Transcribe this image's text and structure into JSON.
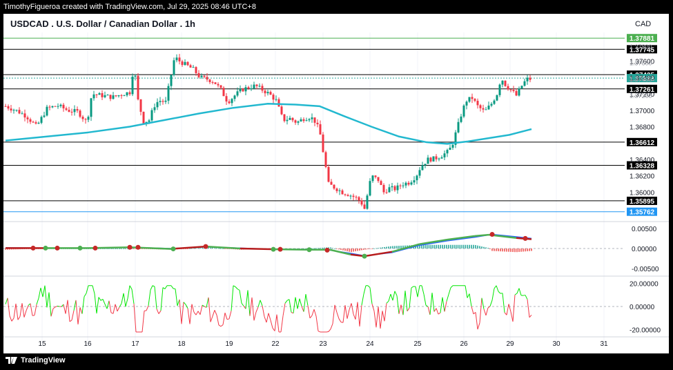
{
  "header": {
    "attribution": "TimothyFigueroa created with TradingView.com, Jul 29, 2025 08:46 UTC+8"
  },
  "footer": {
    "brand": "TradingView",
    "logo_icon": "tradingview-logo-icon"
  },
  "chart_data": {
    "type": "candlestick",
    "title": "USDCAD . U.S. Dollar / Canadian Dollar . 1h",
    "currency": "CAD",
    "x_ticks": [
      "15",
      "16",
      "17",
      "18",
      "19",
      "22",
      "23",
      "24",
      "25",
      "26",
      "29",
      "30",
      "31"
    ],
    "y_ticks": [
      "1.37600",
      "1.37400",
      "1.37200",
      "1.37000",
      "1.36800",
      "1.36400",
      "1.36200",
      "1.36000"
    ],
    "y_overlap_ticks": [
      "1.37800",
      "1.37600",
      "1.37400",
      "1.37200"
    ],
    "ylim": [
      1.3565,
      1.3795
    ],
    "price_lines": [
      {
        "label": "1.37881",
        "value": 1.37881,
        "color": "#4caf50"
      },
      {
        "label": "1.37745",
        "value": 1.37745,
        "color": "#000000"
      },
      {
        "label": "1.37435",
        "value": 1.37435,
        "color": "#000000"
      },
      {
        "label": "1.37393",
        "value": 1.37393,
        "color": "#26a69a"
      },
      {
        "label": "1.37261",
        "value": 1.37261,
        "color": "#000000"
      },
      {
        "label": "1.36612",
        "value": 1.36612,
        "color": "#000000"
      },
      {
        "label": "1.36328",
        "value": 1.36328,
        "color": "#000000"
      },
      {
        "label": "1.35895",
        "value": 1.35895,
        "color": "#000000"
      },
      {
        "label": "1.35762",
        "value": 1.35762,
        "color": "#2196f3"
      }
    ],
    "close_path": [
      [
        0,
        1.3705
      ],
      [
        15,
        1.37
      ],
      [
        30,
        1.3693
      ],
      [
        45,
        1.368
      ],
      [
        60,
        1.3702
      ],
      [
        75,
        1.3706
      ],
      [
        90,
        1.37
      ],
      [
        105,
        1.3698
      ],
      [
        118,
        1.3685
      ],
      [
        125,
        1.372
      ],
      [
        140,
        1.3718
      ],
      [
        155,
        1.3716
      ],
      [
        170,
        1.372
      ],
      [
        180,
        1.3722
      ],
      [
        186,
        1.3755
      ],
      [
        192,
        1.3712
      ],
      [
        200,
        1.3686
      ],
      [
        208,
        1.3688
      ],
      [
        215,
        1.3705
      ],
      [
        222,
        1.3712
      ],
      [
        232,
        1.371
      ],
      [
        238,
        1.3735
      ],
      [
        245,
        1.3765
      ],
      [
        252,
        1.376
      ],
      [
        262,
        1.3755
      ],
      [
        272,
        1.375
      ],
      [
        282,
        1.374
      ],
      [
        292,
        1.3738
      ],
      [
        302,
        1.3735
      ],
      [
        312,
        1.3725
      ],
      [
        322,
        1.371
      ],
      [
        332,
        1.3718
      ],
      [
        342,
        1.3725
      ],
      [
        352,
        1.3728
      ],
      [
        362,
        1.373
      ],
      [
        372,
        1.3725
      ],
      [
        382,
        1.372
      ],
      [
        392,
        1.3712
      ],
      [
        402,
        1.3688
      ],
      [
        412,
        1.369
      ],
      [
        422,
        1.3685
      ],
      [
        432,
        1.369
      ],
      [
        442,
        1.3692
      ],
      [
        450,
        1.3685
      ],
      [
        456,
        1.367
      ],
      [
        462,
        1.364
      ],
      [
        468,
        1.361
      ],
      [
        478,
        1.3605
      ],
      [
        488,
        1.36
      ],
      [
        498,
        1.3597
      ],
      [
        508,
        1.3593
      ],
      [
        515,
        1.3588
      ],
      [
        520,
        1.358
      ],
      [
        525,
        1.36
      ],
      [
        530,
        1.362
      ],
      [
        540,
        1.3615
      ],
      [
        548,
        1.36
      ],
      [
        555,
        1.3605
      ],
      [
        565,
        1.3604
      ],
      [
        575,
        1.361
      ],
      [
        585,
        1.3612
      ],
      [
        595,
        1.362
      ],
      [
        602,
        1.3632
      ],
      [
        612,
        1.364
      ],
      [
        622,
        1.3641
      ],
      [
        632,
        1.3645
      ],
      [
        642,
        1.365
      ],
      [
        648,
        1.366
      ],
      [
        655,
        1.368
      ],
      [
        662,
        1.37
      ],
      [
        668,
        1.3712
      ],
      [
        676,
        1.3715
      ],
      [
        684,
        1.3705
      ],
      [
        694,
        1.3698
      ],
      [
        704,
        1.3708
      ],
      [
        712,
        1.372
      ],
      [
        718,
        1.374
      ],
      [
        725,
        1.373
      ],
      [
        732,
        1.3725
      ],
      [
        740,
        1.3718
      ],
      [
        748,
        1.373
      ],
      [
        755,
        1.3738
      ],
      [
        762,
        1.3738
      ]
    ],
    "ma_path": [
      [
        0,
        1.3663
      ],
      [
        60,
        1.3668
      ],
      [
        120,
        1.3673
      ],
      [
        180,
        1.368
      ],
      [
        230,
        1.3688
      ],
      [
        280,
        1.3696
      ],
      [
        330,
        1.3703
      ],
      [
        380,
        1.3708
      ],
      [
        420,
        1.3707
      ],
      [
        455,
        1.3705
      ],
      [
        490,
        1.3693
      ],
      [
        530,
        1.368
      ],
      [
        570,
        1.3668
      ],
      [
        610,
        1.3661
      ],
      [
        640,
        1.3659
      ],
      [
        670,
        1.3662
      ],
      [
        700,
        1.3666
      ],
      [
        730,
        1.367
      ],
      [
        762,
        1.3677
      ]
    ],
    "macd_ylim": [
      -0.0065,
      0.0065
    ],
    "macd_ticks": [
      "0.00500",
      "0.00000",
      "-0.00500"
    ],
    "macd_line": [
      [
        0,
        0.0001
      ],
      [
        60,
        0.0001
      ],
      [
        120,
        0.0001
      ],
      [
        180,
        0.0003
      ],
      [
        240,
        -0.0001
      ],
      [
        290,
        0.0005
      ],
      [
        340,
        0.0
      ],
      [
        390,
        -0.0002
      ],
      [
        440,
        -0.0003
      ],
      [
        470,
        -0.0003
      ],
      [
        500,
        -0.0015
      ],
      [
        520,
        -0.0019
      ],
      [
        560,
        -0.0008
      ],
      [
        600,
        0.0011
      ],
      [
        640,
        0.0022
      ],
      [
        680,
        0.0031
      ],
      [
        700,
        0.0034
      ],
      [
        740,
        0.0026
      ],
      [
        762,
        0.0023
      ]
    ],
    "macd_signal": [
      [
        0,
        0.0002
      ],
      [
        60,
        0.0001
      ],
      [
        120,
        0.0001
      ],
      [
        180,
        0.0003
      ],
      [
        240,
        0.0
      ],
      [
        290,
        0.0004
      ],
      [
        340,
        0.0001
      ],
      [
        390,
        -0.0002
      ],
      [
        440,
        -0.0003
      ],
      [
        470,
        -0.0004
      ],
      [
        500,
        -0.0012
      ],
      [
        520,
        -0.0018
      ],
      [
        560,
        -0.001
      ],
      [
        600,
        0.0008
      ],
      [
        640,
        0.0019
      ],
      [
        680,
        0.0028
      ],
      [
        705,
        0.0035
      ],
      [
        740,
        0.0029
      ],
      [
        762,
        0.0025
      ]
    ],
    "macd_cross_markers": [
      {
        "x": 40,
        "v": 0.0001,
        "color": "#c62828"
      },
      {
        "x": 58,
        "v": 0.0001,
        "color": "#4caf50"
      },
      {
        "x": 75,
        "v": 0.0001,
        "color": "#c62828"
      },
      {
        "x": 108,
        "v": 0.0001,
        "color": "#4caf50"
      },
      {
        "x": 130,
        "v": 0.0001,
        "color": "#c62828"
      },
      {
        "x": 180,
        "v": 0.0003,
        "color": "#c62828"
      },
      {
        "x": 192,
        "v": 0.0003,
        "color": "#c62828"
      },
      {
        "x": 243,
        "v": -0.0001,
        "color": "#4caf50"
      },
      {
        "x": 290,
        "v": 0.0005,
        "color": "#c62828"
      },
      {
        "x": 388,
        "v": -0.0002,
        "color": "#4caf50"
      },
      {
        "x": 398,
        "v": -0.0002,
        "color": "#c62828"
      },
      {
        "x": 440,
        "v": -0.0003,
        "color": "#4caf50"
      },
      {
        "x": 466,
        "v": -0.0004,
        "color": "#c62828"
      },
      {
        "x": 520,
        "v": -0.0019,
        "color": "#4caf50"
      },
      {
        "x": 705,
        "v": 0.0035,
        "color": "#c62828"
      },
      {
        "x": 753,
        "v": 0.0025,
        "color": "#c62828"
      }
    ],
    "osc_ylim": [
      -25,
      25
    ],
    "osc_ticks": [
      "20.00000",
      "0.00000",
      "-20.00000"
    ]
  }
}
